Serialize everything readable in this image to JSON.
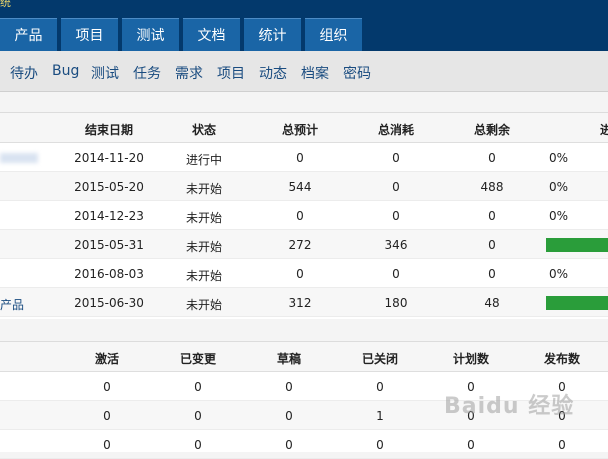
{
  "brand": "统",
  "nav": {
    "tabs": [
      "产品",
      "项目",
      "测试",
      "文档",
      "统计",
      "组织"
    ],
    "sub": [
      "待办",
      "Bug",
      "测试",
      "任务",
      "需求",
      "项目",
      "动态",
      "档案",
      "密码"
    ]
  },
  "projects": {
    "headers": [
      "结束日期",
      "状态",
      "总预计",
      "总消耗",
      "总剩余",
      "进"
    ],
    "rows": [
      {
        "name": "",
        "end": "2014-11-20",
        "status": "进行中",
        "estimate": "0",
        "consumed": "0",
        "left": "0",
        "progress": "0%",
        "bar": false
      },
      {
        "name": "",
        "end": "2015-05-20",
        "status": "未开始",
        "estimate": "544",
        "consumed": "0",
        "left": "488",
        "progress": "0%",
        "bar": false
      },
      {
        "name": "",
        "end": "2014-12-23",
        "status": "未开始",
        "estimate": "0",
        "consumed": "0",
        "left": "0",
        "progress": "0%",
        "bar": false
      },
      {
        "name": "",
        "end": "2015-05-31",
        "status": "未开始",
        "estimate": "272",
        "consumed": "346",
        "left": "0",
        "progress": "",
        "bar": true
      },
      {
        "name": "",
        "end": "2016-08-03",
        "status": "未开始",
        "estimate": "0",
        "consumed": "0",
        "left": "0",
        "progress": "0%",
        "bar": false
      },
      {
        "name": "产品",
        "end": "2015-06-30",
        "status": "未开始",
        "estimate": "312",
        "consumed": "180",
        "left": "48",
        "progress": "",
        "bar": true
      }
    ]
  },
  "products": {
    "headers": [
      "激活",
      "已变更",
      "草稿",
      "已关闭",
      "计划数",
      "发布数"
    ],
    "rows": [
      [
        "0",
        "0",
        "0",
        "0",
        "0",
        "0"
      ],
      [
        "0",
        "0",
        "0",
        "1",
        "0",
        "0"
      ],
      [
        "0",
        "0",
        "0",
        "0",
        "0",
        "0"
      ]
    ]
  },
  "watermark": "Baidu 经验",
  "colors": {
    "topbar": "#03396c",
    "tab": "#1a65a6",
    "progress": "#2a9d3a"
  }
}
